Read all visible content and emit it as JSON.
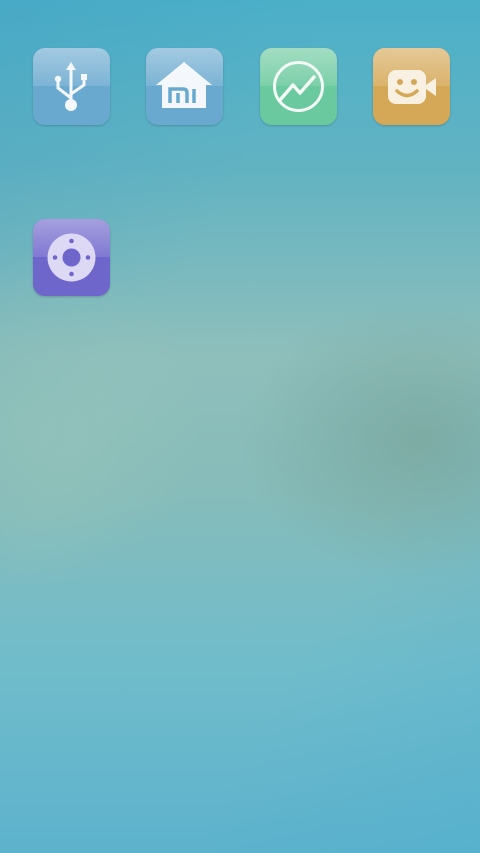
{
  "home_screen": {
    "apps": [
      {
        "icon": "usb-icon",
        "color": "#6aa9cf"
      },
      {
        "icon": "mi-home-icon",
        "color": "#6aa9cf"
      },
      {
        "icon": "trend-chart-icon",
        "color": "#6ac99e"
      },
      {
        "icon": "video-call-smiley-icon",
        "color": "#d5a857"
      },
      {
        "icon": "remote-control-icon",
        "color": "#6f66cc"
      }
    ]
  }
}
